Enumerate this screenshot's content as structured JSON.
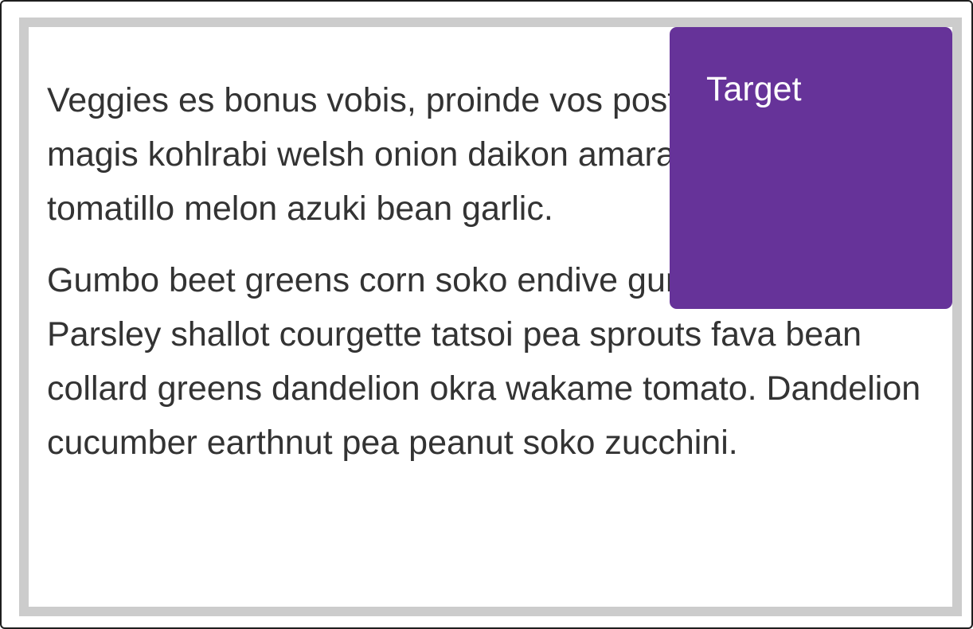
{
  "paragraphs": [
    "Veggies es bonus vobis, proinde vos postulo essum magis kohlrabi welsh onion daikon amaranth tatsoi tomatillo melon azuki bean garlic.",
    "Gumbo beet greens corn soko endive gumbo gourd. Parsley shallot courgette tatsoi pea sprouts fava bean collard greens dandelion okra wakame tomato. Dandelion cucumber earthnut pea peanut soko zucchini."
  ],
  "target": {
    "label": "Target",
    "background_color": "#663399",
    "text_color": "#ffffff"
  },
  "container": {
    "border_color": "#cccccc"
  }
}
